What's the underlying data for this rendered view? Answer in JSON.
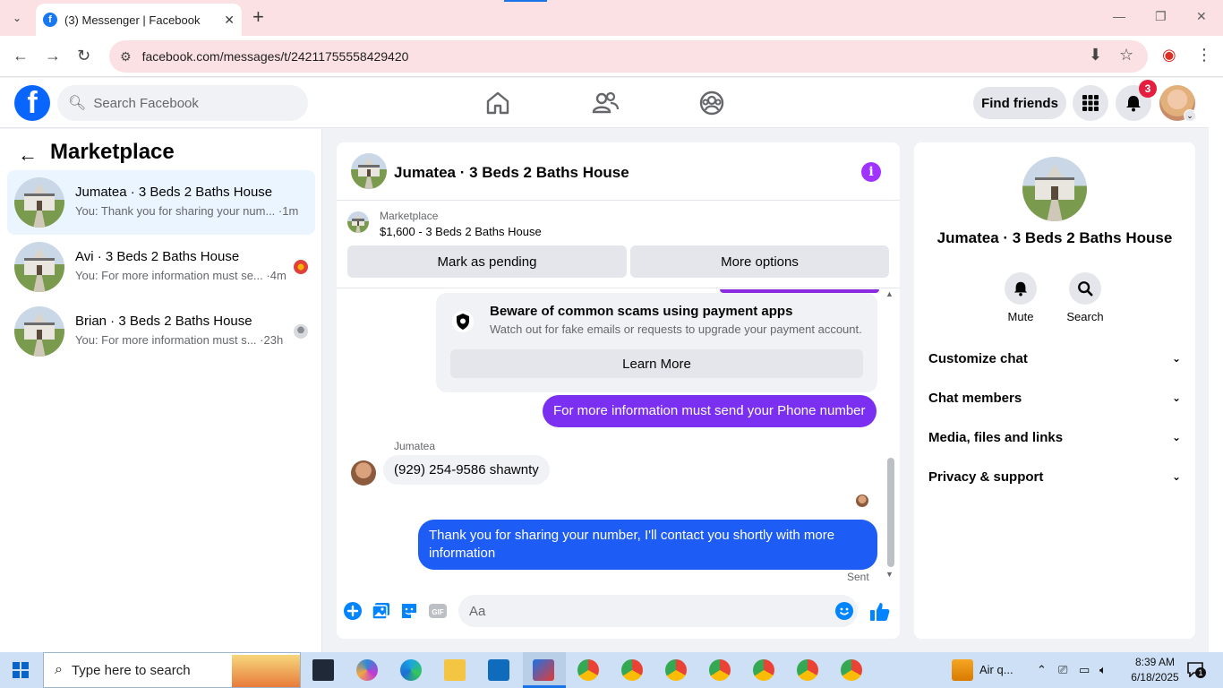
{
  "browser": {
    "tab_title": "(3) Messenger | Facebook",
    "tab_favicon": "f",
    "url": "facebook.com/messages/t/24211755558429420"
  },
  "fb_header": {
    "search_placeholder": "Search Facebook",
    "find_friends": "Find friends",
    "notif_count": "3"
  },
  "left": {
    "title": "Marketplace",
    "conversations": [
      {
        "name": "Jumatea · 3 Beds 2 Baths House",
        "preview": "You: Thank you for sharing your num... ·1m"
      },
      {
        "name": "Avi · 3 Beds 2 Baths House",
        "preview": "You: For more information must se... ·4m"
      },
      {
        "name": "Brian · 3 Beds 2 Baths House",
        "preview": "You: For more information must s... ·23h"
      }
    ]
  },
  "chat": {
    "title": "Jumatea · 3 Beds 2 Baths House",
    "listing_label": "Marketplace",
    "listing_price": "$1,600 - 3 Beds 2 Baths House",
    "mark_pending": "Mark as pending",
    "more_options": "More options",
    "warning_title": "Beware of common scams using payment apps",
    "warning_sub": "Watch out for fake emails or requests to upgrade your payment account.",
    "learn_more": "Learn More",
    "msg_out_1": "For more information must send your Phone number",
    "sender_name": "Jumatea",
    "msg_in_1": "(929) 254-9586 shawnty",
    "msg_out_2": "Thank you for sharing your number, I'll contact you shortly with more information",
    "sent_label": "Sent",
    "composer_placeholder": "Aa"
  },
  "details": {
    "name": "Jumatea · 3 Beds 2 Baths House",
    "mute": "Mute",
    "search": "Search",
    "rows": [
      "Customize chat",
      "Chat members",
      "Media, files and links",
      "Privacy & support"
    ]
  },
  "taskbar": {
    "search_placeholder": "Type here to search",
    "weather": "Air q...",
    "time": "8:39 AM",
    "date": "6/18/2025",
    "notif_count": "1"
  },
  "colors": {
    "fb_blue": "#0866ff",
    "outgoing_blue": "#1e5cf6",
    "outgoing_purple": "#7b2ff0",
    "tab_pink": "#fbe1e3"
  }
}
